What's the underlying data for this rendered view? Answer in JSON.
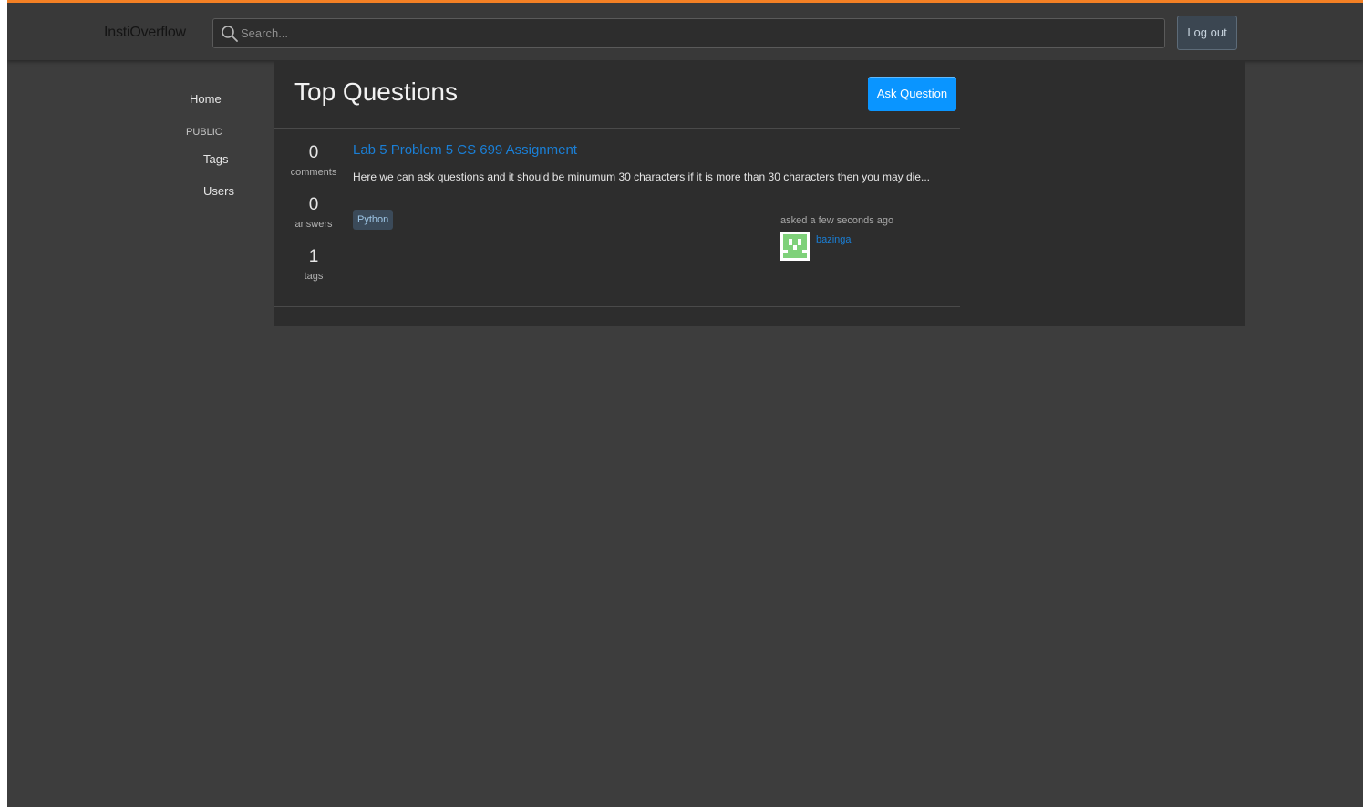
{
  "header": {
    "brand": "InstiOverflow",
    "search_placeholder": "Search...",
    "search_icon": "search-icon",
    "logout_label": "Log out"
  },
  "sidebar": {
    "home": "Home",
    "section_label": "PUBLIC",
    "tags": "Tags",
    "users": "Users"
  },
  "main": {
    "title": "Top Questions",
    "ask_label": "Ask Question",
    "questions": [
      {
        "comments": "0",
        "comments_label": "comments",
        "answers": "0",
        "answers_label": "answers",
        "tags_count": "1",
        "tags_label": "tags",
        "title": "Lab 5 Problem 5 CS 699 Assignment",
        "excerpt": "Here we can ask questions and it should be minumum 30 characters if it is more than 30 characters then you may die...",
        "tags": [
          "Python"
        ],
        "asked": "asked a few seconds ago",
        "user": "bazinga"
      }
    ]
  },
  "colors": {
    "accent_top": "#f48024",
    "link_blue": "#1a7fd6",
    "button_blue": "#0a95ff",
    "avatar_green": "#7fd17a"
  }
}
